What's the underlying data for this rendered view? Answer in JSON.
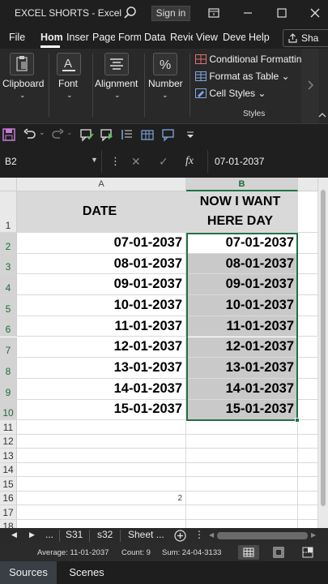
{
  "titlebar": {
    "title": "EXCEL SHORTS  -  Excel",
    "signin": "Sign in"
  },
  "menu": {
    "tabs": [
      "File",
      "Hom",
      "Inser",
      "Page",
      "Form",
      "Data",
      "Revie",
      "View",
      "Deve",
      "Help"
    ],
    "share": "Sha"
  },
  "ribbon": {
    "groups": [
      "Clipboard",
      "Font",
      "Alignment",
      "Number"
    ],
    "styles_items": [
      "Conditional Formatting",
      "Format as Table",
      "Cell Styles"
    ],
    "styles_label": "Styles"
  },
  "formula": {
    "namebox": "B2",
    "value": "07-01-2037"
  },
  "sheet": {
    "columns": [
      "A",
      "B"
    ],
    "header_a": "DATE",
    "header_b_line1": "NOW I WANT",
    "header_b_line2": "HERE DAY",
    "row_numbers": [
      "1",
      "2",
      "3",
      "4",
      "5",
      "6",
      "7",
      "8",
      "9",
      "10",
      "11",
      "12",
      "13",
      "14",
      "15",
      "16",
      "17",
      "18"
    ],
    "col_a": [
      "07-01-2037",
      "08-01-2037",
      "09-01-2037",
      "10-01-2037",
      "11-01-2037",
      "12-01-2037",
      "13-01-2037",
      "14-01-2037",
      "15-01-2037"
    ],
    "col_b": [
      "07-01-2037",
      "08-01-2037",
      "09-01-2037",
      "10-01-2037",
      "11-01-2037",
      "12-01-2037",
      "13-01-2037",
      "14-01-2037",
      "15-01-2037"
    ],
    "row16_a": "2"
  },
  "sheettabs": {
    "ellipsis": "...",
    "tabs": [
      "S31",
      "s32",
      "Sheet ..."
    ]
  },
  "status": {
    "average": "Average: 11-01-2037",
    "count": "Count: 9",
    "sum": "Sum: 24-04-3133"
  },
  "bottom": {
    "sources": "Sources",
    "scenes": "Scenes"
  },
  "colors": {
    "accent_green": "#217346",
    "selection_grey": "#c9c9c9",
    "header_grey": "#d9d9d9"
  }
}
